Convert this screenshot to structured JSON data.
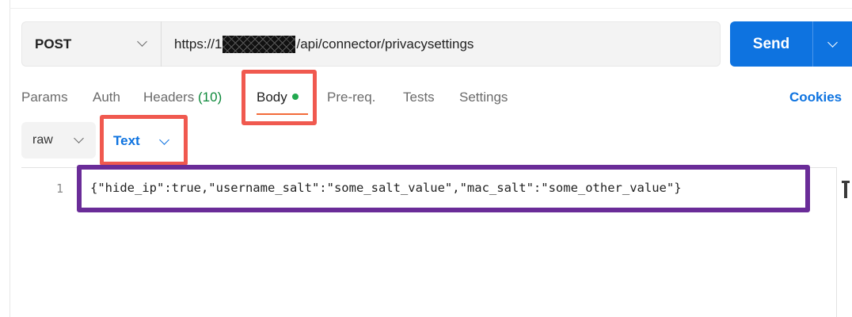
{
  "request": {
    "method": "POST",
    "url_prefix": "https://1",
    "url_suffix": "/api/connector/privacysettings",
    "send_label": "Send"
  },
  "tabs": [
    {
      "label": "Params"
    },
    {
      "label": "Auth"
    },
    {
      "label": "Headers",
      "count": "(10)"
    },
    {
      "label": "Body"
    },
    {
      "label": "Pre-req."
    },
    {
      "label": "Tests"
    },
    {
      "label": "Settings"
    }
  ],
  "cookies_label": "Cookies",
  "body_options": {
    "mode": "raw",
    "format": "Text"
  },
  "editor": {
    "line_number": "1",
    "code": "{\"hide_ip\":true,\"username_salt\":\"some_salt_value\",\"mac_salt\":\"some_other_value\"}"
  },
  "colors": {
    "send_button": "#0e73e0",
    "annotation_red": "#f0594f",
    "annotation_purple": "#6a2c98",
    "active_tab_underline": "#f26b3a",
    "body_dot": "#22a94f"
  }
}
